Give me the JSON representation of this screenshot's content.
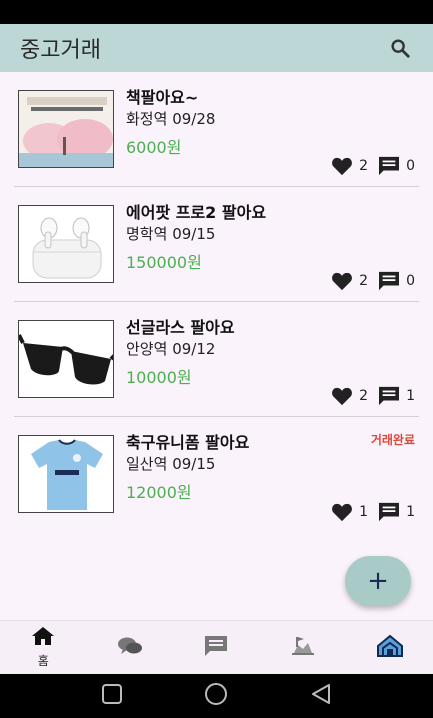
{
  "app_bar": {
    "title": "중고거래",
    "search_icon": "search-icon"
  },
  "items": [
    {
      "title": "책팔아요~",
      "location": "화정역",
      "date": "09/28",
      "price": "6000원",
      "likes": "2",
      "comments": "0",
      "sold_label": "",
      "image": "book-cover-image"
    },
    {
      "title": "에어팟 프로2 팔아요",
      "location": "명학역",
      "date": "09/15",
      "price": "150000원",
      "likes": "2",
      "comments": "0",
      "sold_label": "",
      "image": "airpods-image"
    },
    {
      "title": "선글라스 팔아요",
      "location": "안양역",
      "date": "09/12",
      "price": "10000원",
      "likes": "2",
      "comments": "1",
      "sold_label": "",
      "image": "sunglasses-image"
    },
    {
      "title": "축구유니폼 팔아요",
      "location": "일산역",
      "date": "09/15",
      "price": "12000원",
      "likes": "1",
      "comments": "1",
      "sold_label": "거래완료",
      "image": "jersey-image"
    }
  ],
  "fab": {
    "label": "+"
  },
  "bottom_nav": [
    {
      "label": "홈",
      "icon": "home-icon"
    },
    {
      "label": "",
      "icon": "chat-bubbles-icon"
    },
    {
      "label": "",
      "icon": "message-icon"
    },
    {
      "label": "",
      "icon": "community-icon"
    },
    {
      "label": "",
      "icon": "my-home-icon"
    }
  ],
  "colors": {
    "app_bar": "#bcd7d5",
    "price": "#4caf50",
    "sold": "#d64a3a",
    "background": "#fbf3fb"
  }
}
